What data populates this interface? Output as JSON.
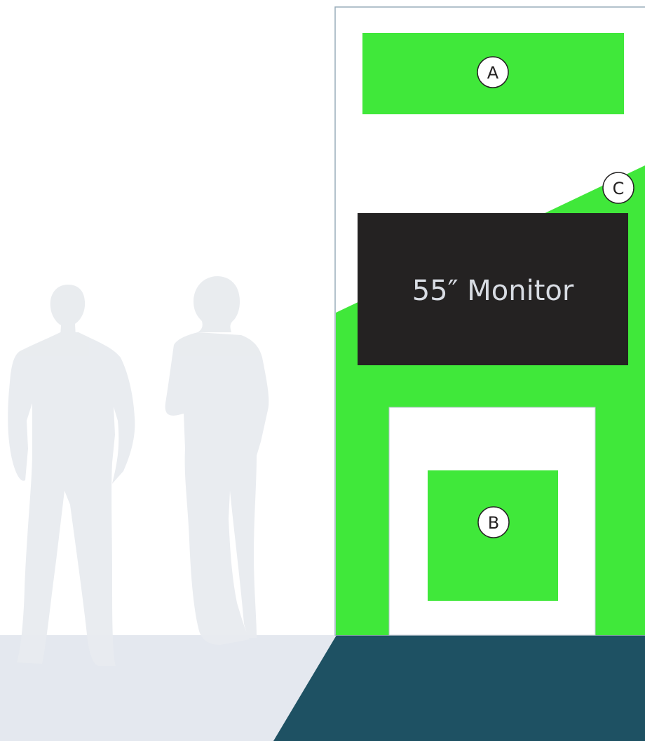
{
  "diagram": {
    "monitor_label": "55″ Monitor",
    "marker_a": "A",
    "marker_b": "B",
    "marker_c": "C"
  },
  "colors": {
    "accent_green": "#40E83A",
    "monitor_dark": "#242222",
    "carpet_teal": "#1E5163",
    "floor_gray": "#E4E8EF",
    "silhouette": "#E8EBEF",
    "wall_outline": "#9AAEBB"
  }
}
